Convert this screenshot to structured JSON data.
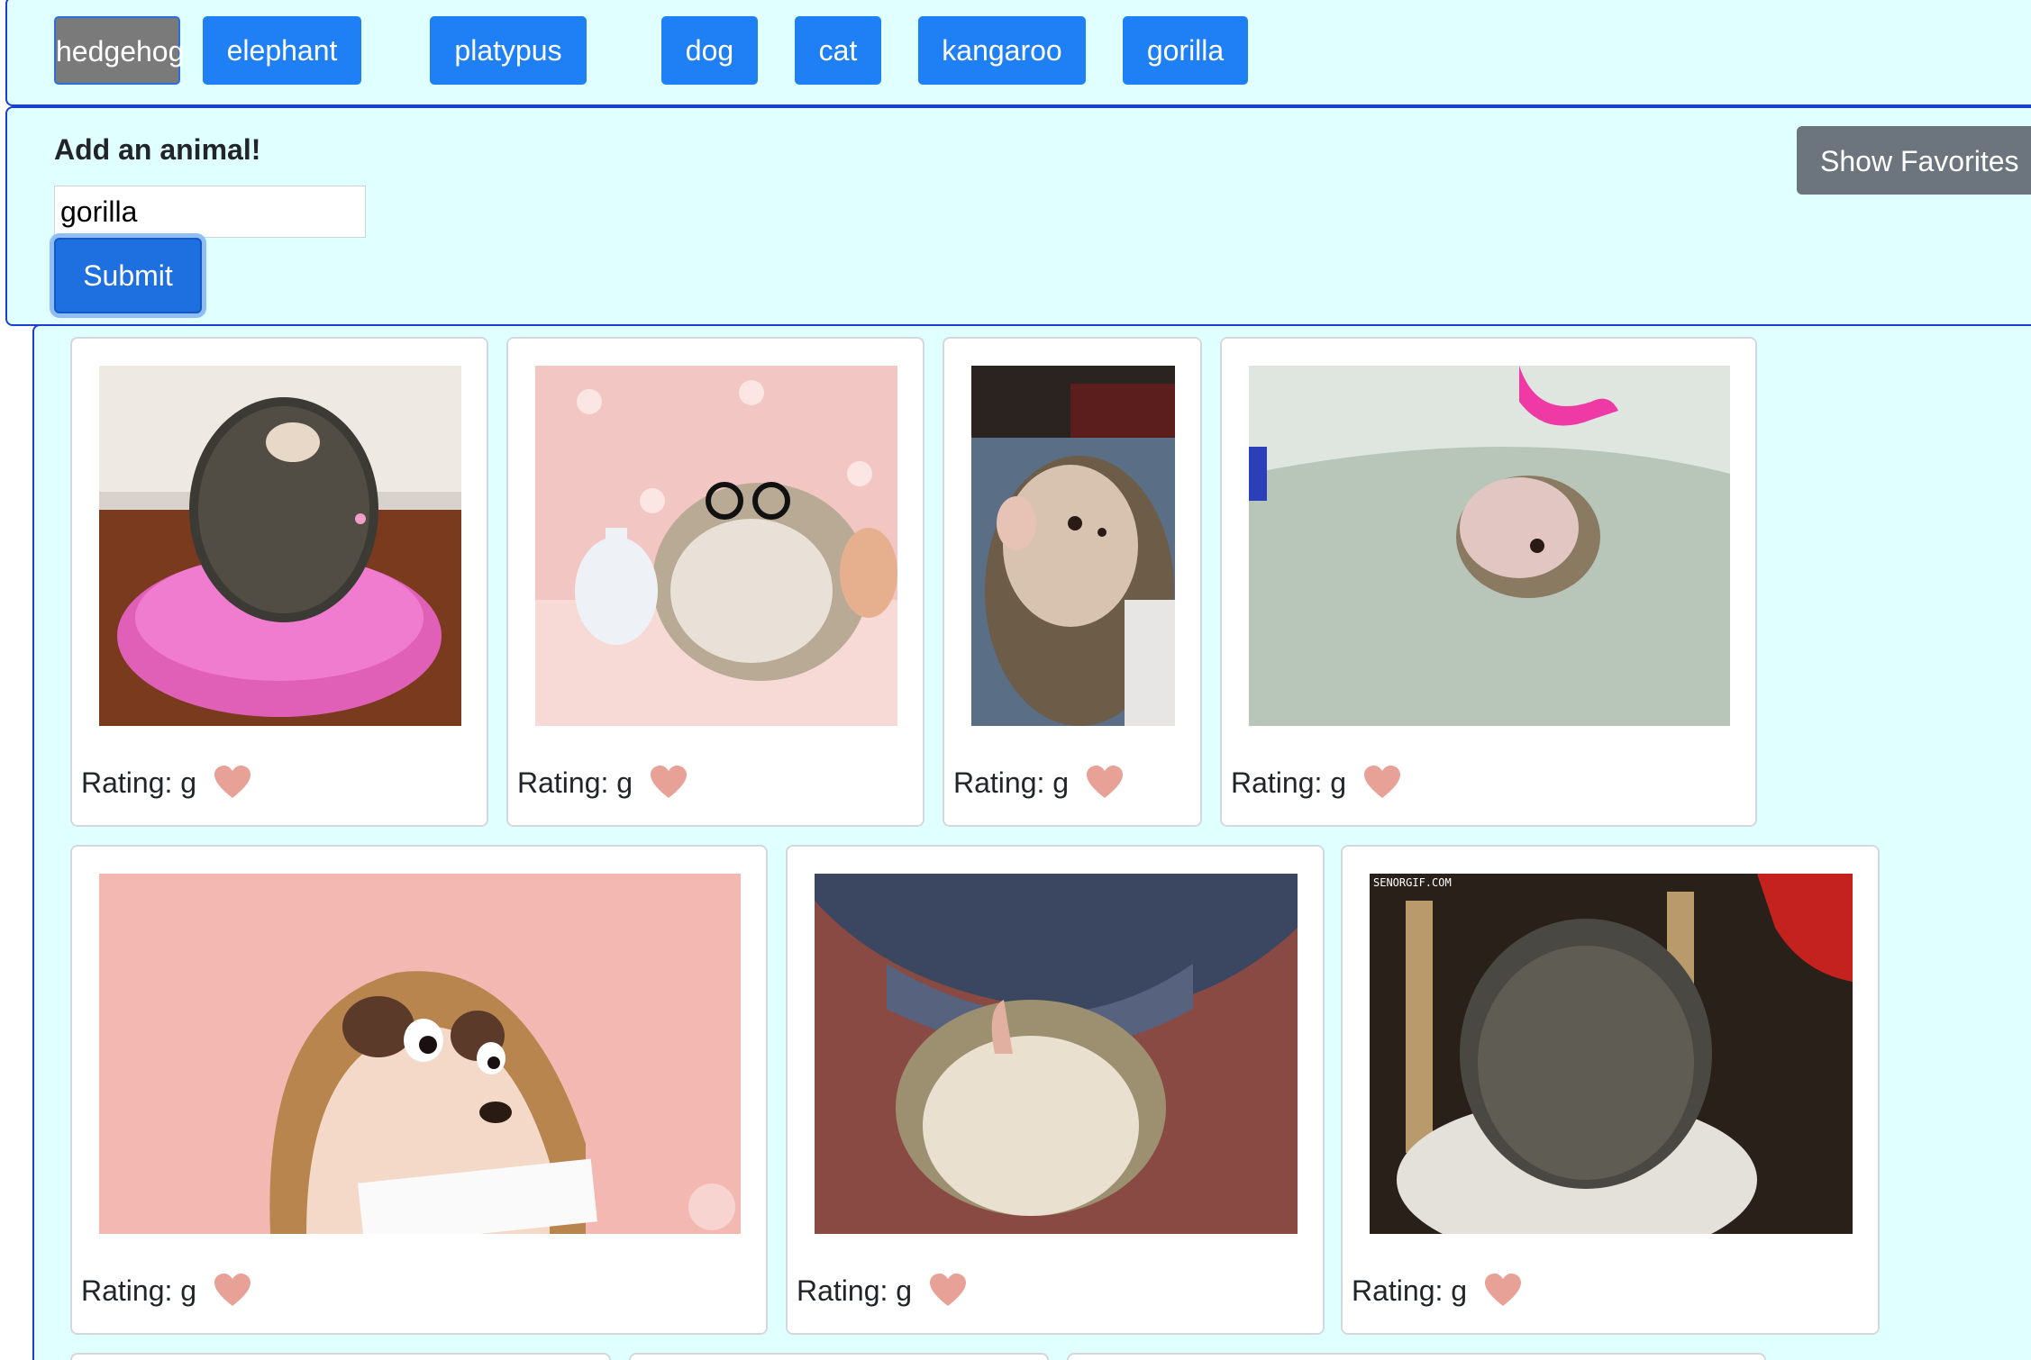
{
  "animals": [
    "hedgehog",
    "elephant",
    "platypus",
    "dog",
    "cat",
    "kangaroo",
    "gorilla"
  ],
  "selected_animal": "hedgehog",
  "form": {
    "title": "Add an animal!",
    "input_value": "gorilla",
    "submit_label": "Submit"
  },
  "favorites_button": "Show Favorites",
  "gifs": [
    {
      "rating_label": "Rating: g",
      "subject": "hedgehog on pink cushion"
    },
    {
      "rating_label": "Rating: g",
      "subject": "hedgehog with glasses"
    },
    {
      "rating_label": "Rating: g",
      "subject": "hedgehog on its back"
    },
    {
      "rating_label": "Rating: g",
      "subject": "hedgehog in bath"
    },
    {
      "rating_label": "Rating: g",
      "subject": "cartoon hedgehog with sign"
    },
    {
      "rating_label": "Rating: g",
      "subject": "hedgehog under blanket"
    },
    {
      "rating_label": "Rating: g",
      "subject": "hedgehog in hand",
      "watermark": "SENORGIF.COM"
    }
  ],
  "colors": {
    "panel_bg": "#e0ffff",
    "panel_border": "#1a3fcf",
    "primary_button": "#1f80f5",
    "selected_button": "#7a7a7a",
    "secondary_button": "#6c757d",
    "heart": "#e8a196"
  },
  "icons": {
    "favorite": "heart-icon"
  }
}
